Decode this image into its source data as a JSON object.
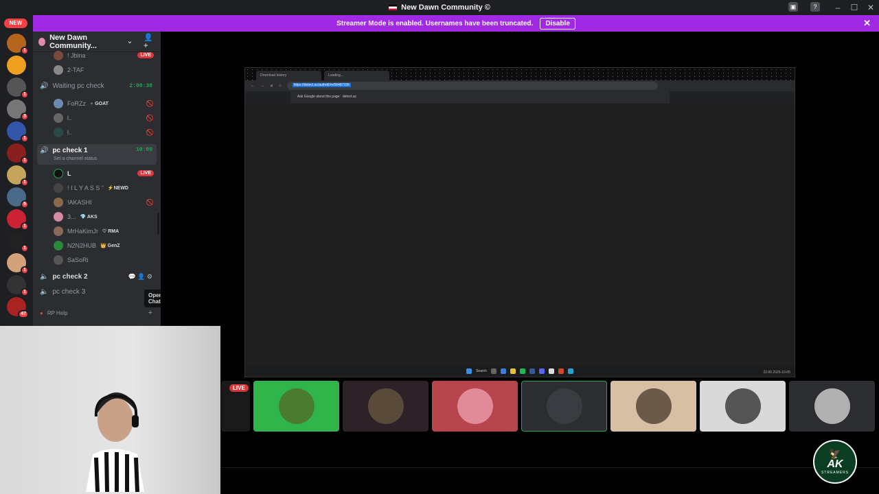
{
  "window": {
    "title": "New Dawn Community ©"
  },
  "banner": {
    "text": "Streamer Mode is enabled. Usernames have been truncated.",
    "button": "Disable"
  },
  "rail": {
    "new_badge": "NEW",
    "servers": [
      {
        "count": "1",
        "color": "#b5651d"
      },
      {
        "count": "",
        "color": "#f0a020"
      },
      {
        "count": "1",
        "color": "#555555"
      },
      {
        "count": "3",
        "color": "#777777"
      },
      {
        "count": "1",
        "color": "#3355aa"
      },
      {
        "count": "1",
        "color": "#8a1f1f"
      },
      {
        "count": "1",
        "color": "#c4a35a"
      },
      {
        "count": "5",
        "color": "#4a6a8a"
      },
      {
        "count": "1",
        "color": "#cc2233"
      },
      {
        "count": "1",
        "color": "#222222"
      },
      {
        "count": "1",
        "color": "#d4a27a"
      },
      {
        "count": "1",
        "color": "#333333"
      },
      {
        "count": "47",
        "color": "#aa2222"
      }
    ]
  },
  "server": {
    "name": "New Dawn Community..."
  },
  "channels": {
    "top_users": [
      {
        "name": "! Jbina",
        "live": "LIVE"
      },
      {
        "name": "2-TAF"
      }
    ],
    "waiting": {
      "name": "Waiting pc check",
      "timer": "2:00:30",
      "users": [
        {
          "name": "FoRZz",
          "tag": "♅ GOAT"
        },
        {
          "name": "l.."
        },
        {
          "name": "l.."
        }
      ]
    },
    "pc1": {
      "name": "pc check 1",
      "timer": "10:00",
      "status": "Set a channel status",
      "users": [
        {
          "name": "L",
          "live": "LIVE"
        },
        {
          "name": "! I L Y A S S ”",
          "tag": "⚡NEWD"
        },
        {
          "name": "!AKASHI"
        },
        {
          "name": "3...",
          "tag": "💎 AKS"
        },
        {
          "name": "MrHaKimJr",
          "tag": "♡ RMA"
        },
        {
          "name": "N2N2HUB",
          "tag": "👑 GenZ"
        },
        {
          "name": "SaSoRi"
        }
      ]
    },
    "pc2": {
      "name": "pc check 2"
    },
    "pc3": {
      "name": "pc check 3"
    },
    "category": {
      "name": "RP Help"
    },
    "tooltip": "Open Chat"
  },
  "screenshare": {
    "tabs": [
      "Download history",
      "Loading..."
    ],
    "url": "https://detect.ac/auth/dl/rn/06487156",
    "suggestion": "Ask Google about this page · detect.ac",
    "taskbar_search": "Search",
    "tray_time": "22:00",
    "tray_date": "2025-10-05"
  },
  "tiles": {
    "live": "LIVE",
    "items": [
      {
        "bg": "#1a1a1a",
        "face": "#1a1a1a"
      },
      {
        "bg": "#2fb54a",
        "face": "#4a7a30"
      },
      {
        "bg": "#2e2228",
        "face": "#5a4a3a"
      },
      {
        "bg": "#b6454e",
        "face": "#e08a9a"
      },
      {
        "bg": "#2b2d31",
        "face": "#3a3c42"
      },
      {
        "bg": "#d7bfa3",
        "face": "#6b5a4a"
      },
      {
        "bg": "#d9d9d9",
        "face": "#555555"
      },
      {
        "bg": "#2b2d31",
        "face": "#b0b0b0"
      }
    ]
  },
  "logo": {
    "text": "AK",
    "sub": "STREAMERS"
  }
}
